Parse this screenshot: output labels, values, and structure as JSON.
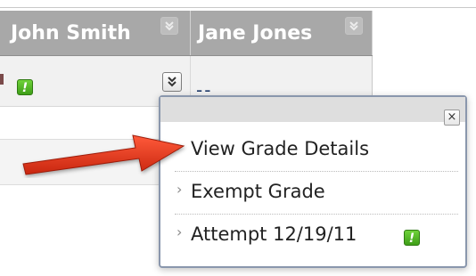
{
  "grade_center": {
    "columns": [
      {
        "header": "John Smith",
        "menu_icon": "chevron-double-down-icon"
      },
      {
        "header": "Jane Jones",
        "menu_icon": "chevron-double-down-icon"
      }
    ],
    "row": {
      "john_cell": {
        "status_icon": "needs-grading-icon",
        "status_symbol": "!",
        "menu_icon": "chevron-double-down-icon"
      },
      "jane_cell": {
        "value": "--"
      }
    }
  },
  "context_menu": {
    "close_symbol": "×",
    "items": [
      {
        "label": "View Grade Details",
        "chevron": "›"
      },
      {
        "label": "Exempt Grade",
        "chevron": "›"
      },
      {
        "label": "Attempt 12/19/11",
        "chevron": "›",
        "status_symbol": "!"
      }
    ]
  },
  "annotation": {
    "arrow_color": "#e53a1f",
    "arrow_icon": "red-pointer-arrow"
  },
  "colors": {
    "header_bg": "#a8a8a8",
    "needs_grading_green": "#4fb625",
    "popup_border": "#8a97ad"
  }
}
